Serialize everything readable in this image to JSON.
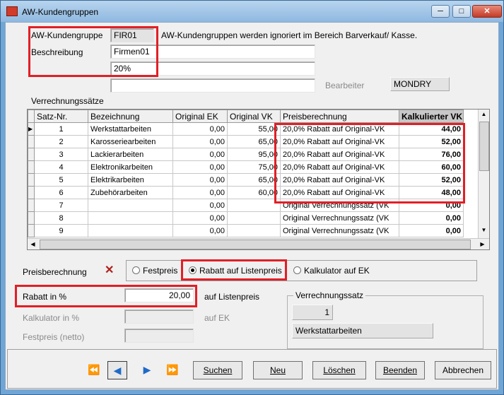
{
  "window": {
    "title": "AW-Kundengruppen",
    "minimize": "─",
    "maximize": "□",
    "close": "✕"
  },
  "form": {
    "kundengruppe_label": "AW-Kundengruppe",
    "kundengruppe_value": "FIR01",
    "hint": "AW-Kundengruppen werden ignoriert im Bereich Barverkauf/ Kasse.",
    "beschreibung_label": "Beschreibung",
    "beschreibung_value": "Firmen01",
    "beschreibung_value2": "20%",
    "beschreibung_value3": "",
    "bearbeiter_label": "Bearbeiter",
    "bearbeiter_value": "MONDRY",
    "verrechnungssaetze_label": "Verrechnungssätze"
  },
  "grid": {
    "columns": [
      "Satz-Nr.",
      "Bezeichnung",
      "Original EK",
      "Original VK",
      "Preisberechnung",
      "Kalkulierter VK"
    ],
    "row_marker": "▶",
    "rows": [
      {
        "nr": "1",
        "bez": "Werkstattarbeiten",
        "ek": "0,00",
        "vk": "55,00",
        "preis": "20,0% Rabatt auf Original-VK",
        "kvk": "44,00"
      },
      {
        "nr": "2",
        "bez": "Karosseriearbeiten",
        "ek": "0,00",
        "vk": "65,00",
        "preis": "20,0% Rabatt auf Original-VK",
        "kvk": "52,00"
      },
      {
        "nr": "3",
        "bez": "Lackierarbeiten",
        "ek": "0,00",
        "vk": "95,00",
        "preis": "20,0% Rabatt auf Original-VK",
        "kvk": "76,00"
      },
      {
        "nr": "4",
        "bez": "Elektronikarbeiten",
        "ek": "0,00",
        "vk": "75,00",
        "preis": "20,0% Rabatt auf Original-VK",
        "kvk": "60,00"
      },
      {
        "nr": "5",
        "bez": "Elektrikarbeiten",
        "ek": "0,00",
        "vk": "65,00",
        "preis": "20,0% Rabatt auf Original-VK",
        "kvk": "52,00"
      },
      {
        "nr": "6",
        "bez": "Zubehörarbeiten",
        "ek": "0,00",
        "vk": "60,00",
        "preis": "20,0% Rabatt auf Original-VK",
        "kvk": "48,00"
      },
      {
        "nr": "7",
        "bez": "",
        "ek": "0,00",
        "vk": "",
        "preis": "Original Verrechnungssatz (VK",
        "kvk": "0,00"
      },
      {
        "nr": "8",
        "bez": "",
        "ek": "0,00",
        "vk": "",
        "preis": "Original Verrechnungssatz (VK",
        "kvk": "0,00"
      },
      {
        "nr": "9",
        "bez": "",
        "ek": "0,00",
        "vk": "",
        "preis": "Original Verrechnungssatz (VK",
        "kvk": "0,00"
      }
    ]
  },
  "preisberechnung": {
    "label": "Preisberechnung",
    "clear": "✕",
    "options": [
      "Festpreis",
      "Rabatt auf Listenpreis",
      "Kalkulator auf EK"
    ],
    "selected": "Rabatt auf Listenpreis"
  },
  "rabatt": {
    "label": "Rabatt in %",
    "value": "20,00",
    "suffix": "auf Listenpreis"
  },
  "kalkulator": {
    "label": "Kalkulator in %",
    "value": "",
    "suffix": "auf EK"
  },
  "festpreis": {
    "label": "Festpreis (netto)",
    "value": ""
  },
  "verrechnungssatz": {
    "title": "Verrechnungssatz",
    "nr": "1",
    "bez": "Werkstattarbeiten"
  },
  "buttons": {
    "first": "⏪",
    "prev": "◀",
    "next": "▶",
    "last": "⏩",
    "suchen": "Suchen",
    "neu": "Neu",
    "loeschen": "Löschen",
    "beenden": "Beenden",
    "abbrechen": "Abbrechen"
  },
  "colors": {
    "highlight": "#e11f26",
    "title_bg": "#b7d4ee",
    "nav_icon": "#1e6ac8"
  }
}
